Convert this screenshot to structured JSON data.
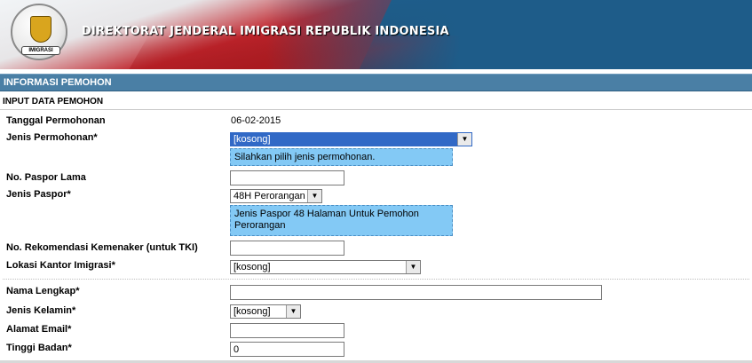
{
  "header": {
    "title": "DIREKTORAT JENDERAL IMIGRASI REPUBLIK INDONESIA",
    "logo_text": "IMIGRASI"
  },
  "section": {
    "title": "INFORMASI PEMOHON",
    "subtitle": "INPUT DATA PEMOHON"
  },
  "form": {
    "tanggal_label": "Tanggal Permohonan",
    "tanggal_value": "06-02-2015",
    "jenis_permohonan_label": "Jenis Permohonan*",
    "jenis_permohonan_value": "[kosong]",
    "jenis_permohonan_hint": "Silahkan pilih jenis permohonan.",
    "paspor_lama_label": "No. Paspor Lama",
    "paspor_lama_value": "",
    "jenis_paspor_label": "Jenis Paspor*",
    "jenis_paspor_value": "48H Perorangan",
    "jenis_paspor_hint": "Jenis Paspor 48 Halaman Untuk Pemohon Perorangan",
    "rekomendasi_label": "No. Rekomendasi Kemenaker (untuk TKI)",
    "rekomendasi_value": "",
    "lokasi_label": "Lokasi Kantor Imigrasi*",
    "lokasi_value": "[kosong]",
    "nama_label": "Nama Lengkap*",
    "nama_value": "",
    "kelamin_label": "Jenis Kelamin*",
    "kelamin_value": "[kosong]",
    "email_label": "Alamat Email*",
    "email_value": "",
    "tinggi_label": "Tinggi Badan*",
    "tinggi_value": "0"
  },
  "colors": {
    "header_blue": "#1f5f8c",
    "section_bar": "#4a7fa5",
    "hint_bg": "#83c9f5",
    "selected_highlight": "#3169c6"
  }
}
